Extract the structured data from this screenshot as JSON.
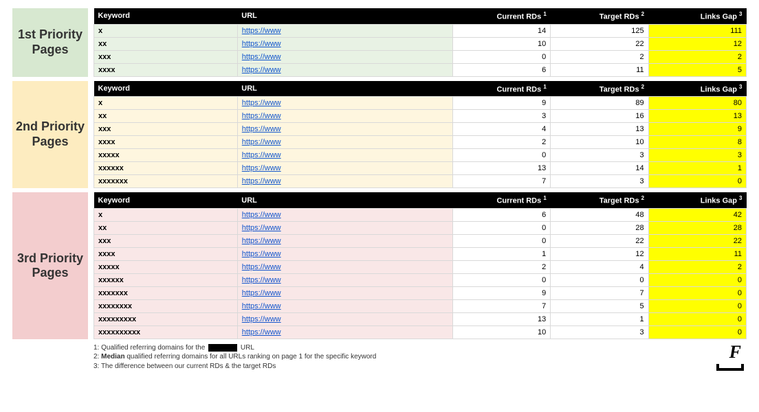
{
  "headers": {
    "keyword": "Keyword",
    "url": "URL",
    "current": "Current RDs",
    "current_sup": "1",
    "target": "Target RDs",
    "target_sup": "2",
    "gap": "Links Gap",
    "gap_sup": "3"
  },
  "groups": [
    {
      "label": "1st Priority Pages",
      "label_class": "p1",
      "table_class": "t1",
      "rows": [
        {
          "keyword": "x",
          "url": "https://www",
          "current": 14,
          "target": 125,
          "gap": 111
        },
        {
          "keyword": "xx",
          "url": "https://www",
          "current": 10,
          "target": 22,
          "gap": 12
        },
        {
          "keyword": "xxx",
          "url": "https://www",
          "current": 0,
          "target": 2,
          "gap": 2
        },
        {
          "keyword": "xxxx",
          "url": "https://www",
          "current": 6,
          "target": 11,
          "gap": 5
        }
      ]
    },
    {
      "label": "2nd Priority Pages",
      "label_class": "p2",
      "table_class": "t2",
      "rows": [
        {
          "keyword": "x",
          "url": "https://www",
          "current": 9,
          "target": 89,
          "gap": 80
        },
        {
          "keyword": "xx",
          "url": "https://www",
          "current": 3,
          "target": 16,
          "gap": 13
        },
        {
          "keyword": "xxx",
          "url": "https://www",
          "current": 4,
          "target": 13,
          "gap": 9
        },
        {
          "keyword": "xxxx",
          "url": "https://www",
          "current": 2,
          "target": 10,
          "gap": 8
        },
        {
          "keyword": "xxxxx",
          "url": "https://www",
          "current": 0,
          "target": 3,
          "gap": 3
        },
        {
          "keyword": "xxxxxx",
          "url": "https://www",
          "current": 13,
          "target": 14,
          "gap": 1
        },
        {
          "keyword": "xxxxxxx",
          "url": "https://www",
          "current": 7,
          "target": 3,
          "gap": 0
        }
      ]
    },
    {
      "label": "3rd Priority Pages",
      "label_class": "p3",
      "table_class": "t3",
      "rows": [
        {
          "keyword": "x",
          "url": "https://www",
          "current": 6,
          "target": 48,
          "gap": 42
        },
        {
          "keyword": "xx",
          "url": "https://www",
          "current": 0,
          "target": 28,
          "gap": 28
        },
        {
          "keyword": "xxx",
          "url": "https://www",
          "current": 0,
          "target": 22,
          "gap": 22
        },
        {
          "keyword": "xxxx",
          "url": "https://www",
          "current": 1,
          "target": 12,
          "gap": 11
        },
        {
          "keyword": "xxxxx",
          "url": "https://www",
          "current": 2,
          "target": 4,
          "gap": 2
        },
        {
          "keyword": "xxxxxx",
          "url": "https://www",
          "current": 0,
          "target": 0,
          "gap": 0
        },
        {
          "keyword": "xxxxxxx",
          "url": "https://www",
          "current": 9,
          "target": 7,
          "gap": 0
        },
        {
          "keyword": "xxxxxxxx",
          "url": "https://www",
          "current": 7,
          "target": 5,
          "gap": 0
        },
        {
          "keyword": "xxxxxxxxx",
          "url": "https://www",
          "current": 13,
          "target": 1,
          "gap": 0
        },
        {
          "keyword": "xxxxxxxxxx",
          "url": "https://www",
          "current": 10,
          "target": 3,
          "gap": 0
        }
      ]
    }
  ],
  "footnotes": {
    "f1_pre": "1: Qualified referring domains for the",
    "f1_post": "URL",
    "f2_pre": "2: ",
    "f2_bold": "Median",
    "f2_post": " qualified referring domains for all URLs ranking on page 1 for the specific keyword",
    "f3": "3: The difference between our current RDs & the target RDs"
  },
  "logo": {
    "letter": "F"
  }
}
